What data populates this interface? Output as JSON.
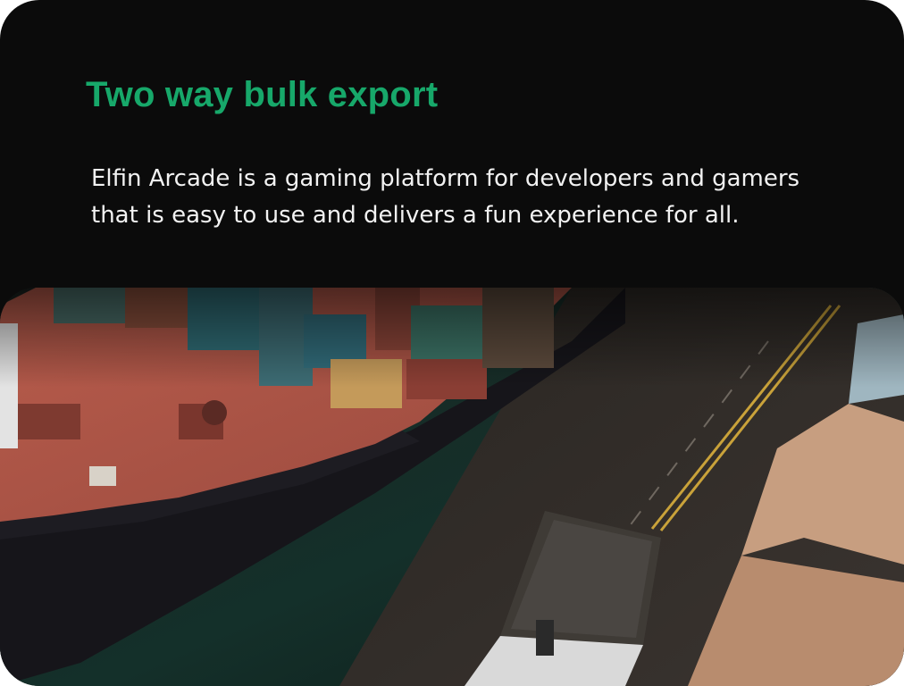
{
  "card": {
    "title": "Two way bulk export",
    "description": "Elfin Arcade is a gaming platform for developers and gamers that is easy to use and delivers a fun experience for all."
  },
  "image": {
    "subject": "aerial view of cargo ship deck, containers and a truck on a road",
    "icon": "photo"
  },
  "colors": {
    "background": "#0b0b0b",
    "accent": "#17a86a",
    "text": "#f2f2f2"
  }
}
